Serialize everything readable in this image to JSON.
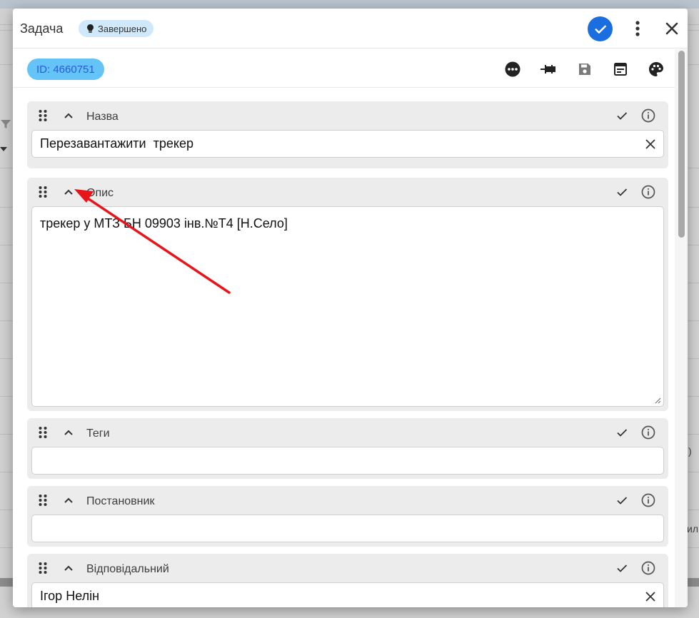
{
  "dialog": {
    "title": "Задача",
    "status": "Завершено",
    "id_label": "ID: 4660751"
  },
  "fields": [
    {
      "label": "Назва",
      "value": "Перезавантажити  трекер",
      "clearable": true
    },
    {
      "label": "Опис",
      "value": "трекер у МТЗ БН 09903 інв.№Т4 [Н.Село]",
      "multiline": true
    },
    {
      "label": "Теги",
      "value": ""
    },
    {
      "label": "Постановник",
      "value": ""
    },
    {
      "label": "Відповідальний",
      "value": "Ігор Нелін",
      "clearable": true
    }
  ],
  "background": {
    "text_right_1": ")",
    "text_right_2": "ил"
  },
  "colors": {
    "accent": "#1b6ee0",
    "status_chip": "#cfe9fb",
    "id_chip": "#64c4f7",
    "id_text": "#2a5bd7",
    "annotation_arrow": "#e8141a"
  },
  "icons": {
    "confirm": "check-icon",
    "more": "more-vert-icon",
    "close": "close-icon",
    "toolbar": [
      "more-horiz-circle-icon",
      "pin-icon",
      "save-icon",
      "calendar-view-icon",
      "palette-icon"
    ]
  }
}
